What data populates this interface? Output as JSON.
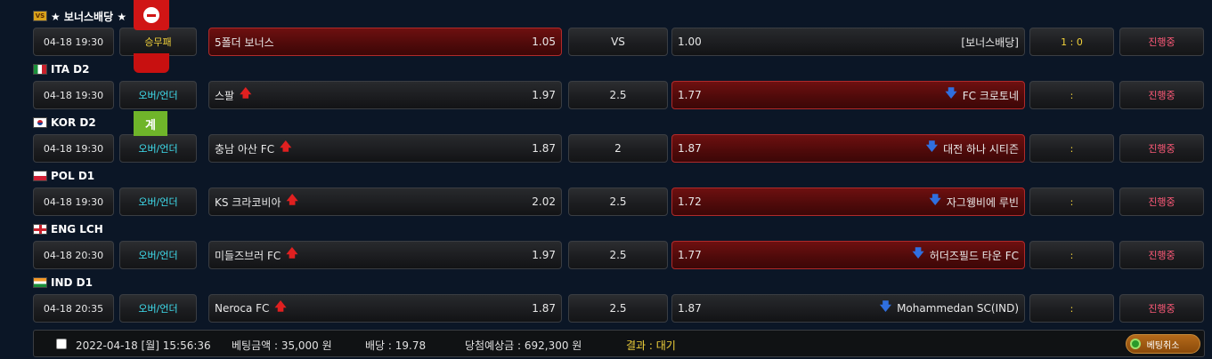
{
  "leagues": [
    {
      "name": "★ 보너스배당 ★",
      "flag": "bonus-flag-icon",
      "match": {
        "date": "04-18 19:30",
        "type": "승무패",
        "home": "5폴더 보너스",
        "home_odds": "1.05",
        "mid": "VS",
        "away_odds": "1.00",
        "away": "[보너스배당]",
        "score": "1 : 0",
        "status": "진행중",
        "selected": "home"
      }
    },
    {
      "name": "ITA D2",
      "flag": "italy-flag-icon",
      "match": {
        "date": "04-18 19:30",
        "type": "오버/언더",
        "home": "스팔",
        "home_odds": "1.97",
        "mid": "2.5",
        "away_odds": "1.77",
        "away": "FC 크로토네",
        "score": ":",
        "status": "진행중",
        "selected": "away"
      }
    },
    {
      "name": "KOR D2",
      "flag": "korea-flag-icon",
      "match": {
        "date": "04-18 19:30",
        "type": "오버/언더",
        "home": "충남 아산 FC",
        "home_odds": "1.87",
        "mid": "2",
        "away_odds": "1.87",
        "away": "대전 하나 시티즌",
        "score": ":",
        "status": "진행중",
        "selected": "away"
      }
    },
    {
      "name": "POL D1",
      "flag": "poland-flag-icon",
      "match": {
        "date": "04-18 19:30",
        "type": "오버/언더",
        "home": "KS 크라코비아",
        "home_odds": "2.02",
        "mid": "2.5",
        "away_odds": "1.72",
        "away": "자그웽비에 루빈",
        "score": ":",
        "status": "진행중",
        "selected": "away"
      }
    },
    {
      "name": "ENG LCH",
      "flag": "england-flag-icon",
      "match": {
        "date": "04-18 20:30",
        "type": "오버/언더",
        "home": "미들즈브러 FC",
        "home_odds": "1.97",
        "mid": "2.5",
        "away_odds": "1.77",
        "away": "허더즈필드 타운 FC",
        "score": ":",
        "status": "진행중",
        "selected": "away"
      }
    },
    {
      "name": "IND D1",
      "flag": "india-flag-icon",
      "match": {
        "date": "04-18 20:35",
        "type": "오버/언더",
        "home": "Neroca FC",
        "home_odds": "1.87",
        "mid": "2.5",
        "away_odds": "1.87",
        "away": "Mohammedan SC(IND)",
        "score": ":",
        "status": "진행중",
        "selected": "none"
      }
    }
  ],
  "float": {
    "green_label": "계"
  },
  "footer": {
    "datetime": "2022-04-18 [월] 15:56:36",
    "bet_amount": "베팅금액 : 35,000 원",
    "odds": "배당 : 19.78",
    "expected": "당첨예상금 : 692,300 원",
    "result": "결과 : 대기",
    "cancel_label": "베팅취소"
  },
  "colors": {
    "selected_bg": "#5a0c0c",
    "type_text": "#3fe0f0",
    "status_text": "#ff5a78",
    "result_text": "#f2d23a"
  }
}
